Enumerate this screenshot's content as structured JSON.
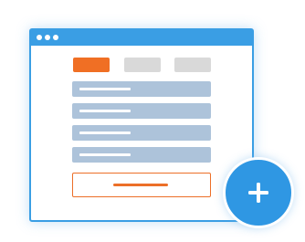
{
  "colors": {
    "window_border": "#3a9ee4",
    "titlebar": "#3a9ee4",
    "active_tab": "#f06f24",
    "inactive_tab": "#d9d9d9",
    "list_row": "#adc3da",
    "cta_accent": "#ec6f28",
    "fab": "#2f97e3"
  },
  "window": {
    "titlebar_dots": 3
  },
  "tabs": {
    "items": [
      {
        "state": "active"
      },
      {
        "state": "inactive"
      },
      {
        "state": "inactive"
      }
    ]
  },
  "list": {
    "row_count": 4
  },
  "fab": {
    "icon": "plus-icon"
  }
}
